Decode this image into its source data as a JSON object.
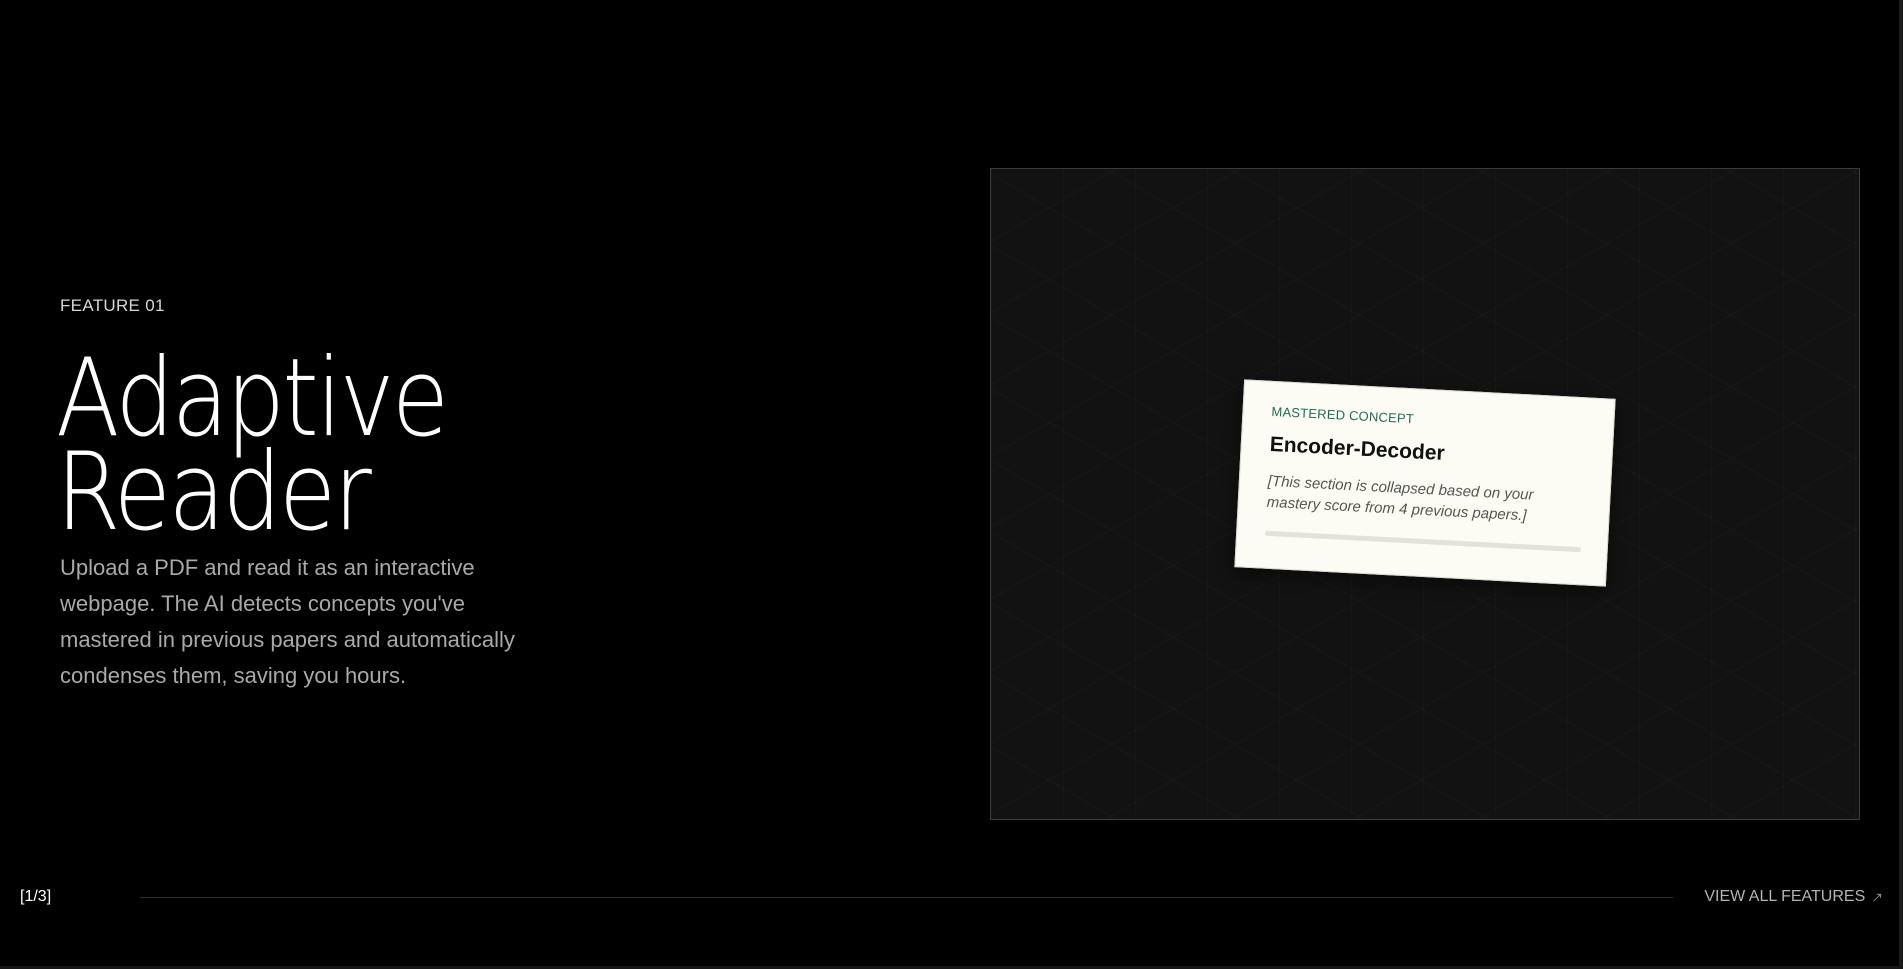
{
  "feature": {
    "eyebrow": "FEATURE 01",
    "title_line1": "Adaptive",
    "title_line2": "Reader",
    "description": "Upload a PDF and read it as an interactive webpage. The AI detects concepts you've mastered in previous papers and automatically condenses them, saving you hours."
  },
  "preview": {
    "card": {
      "tag": "MASTERED CONCEPT",
      "title": "Encoder-Decoder",
      "note": "[This section is collapsed based on your mastery score from 4 previous papers.]"
    }
  },
  "nav": {
    "counter": "[1/3]",
    "view_all_label": "VIEW ALL FEATURES",
    "view_all_icon": "↗"
  },
  "colors": {
    "background": "#000000",
    "accent_green": "#1e6b55",
    "card_bg": "#fcfcf5"
  }
}
